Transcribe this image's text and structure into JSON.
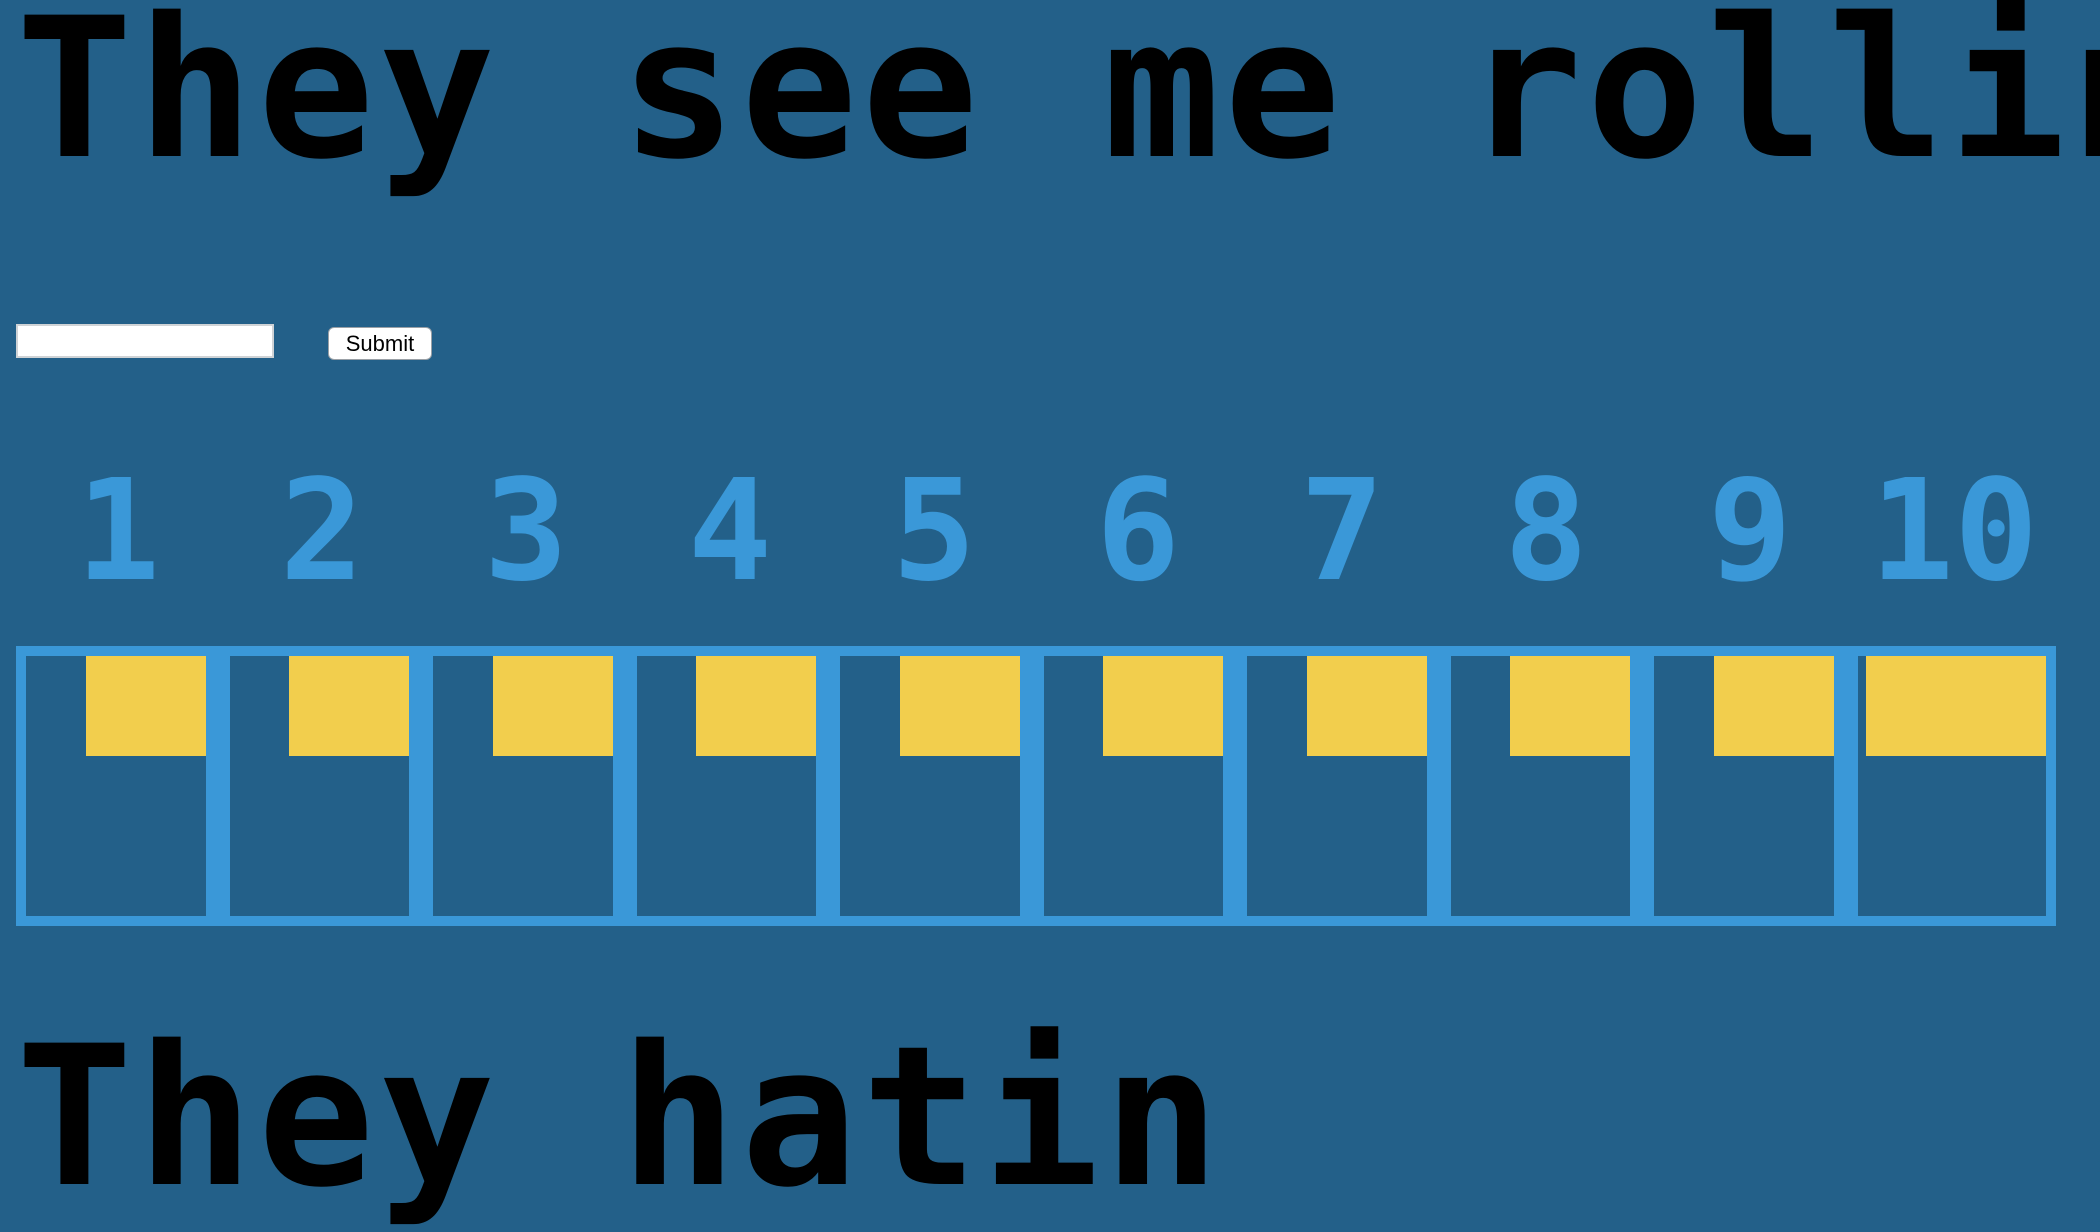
{
  "title_top": "They see me rollin",
  "title_bottom": "They hatin",
  "form": {
    "input_value": "",
    "input_placeholder": "",
    "submit_label": "Submit"
  },
  "frame_numbers": [
    "1",
    "2",
    "3",
    "4",
    "5",
    "6",
    "7",
    "8",
    "9",
    "10"
  ],
  "colors": {
    "background": "#236089",
    "accent": "#3a98d8",
    "score_box": "#f2ce4d",
    "headline": "#000000"
  }
}
